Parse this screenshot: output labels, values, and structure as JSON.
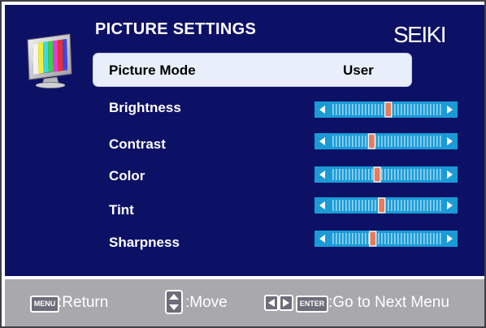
{
  "menu": {
    "title": "PICTURE SETTINGS",
    "brand": "SEIKI",
    "icon": "monitor-color-bars-icon"
  },
  "picture_mode": {
    "label": "Picture Mode",
    "value": "User"
  },
  "settings": [
    {
      "id": "brightness",
      "label": "Brightness",
      "level": 0.52
    },
    {
      "id": "contrast",
      "label": "Contrast",
      "level": 0.37
    },
    {
      "id": "color",
      "label": "Color",
      "level": 0.42
    },
    {
      "id": "tint",
      "label": "Tint",
      "level": 0.46
    },
    {
      "id": "sharpness",
      "label": "Sharpness",
      "level": 0.38
    }
  ],
  "footer": {
    "menu_key": "MENU",
    "return_text": ":Return",
    "move_text": ":Move",
    "enter_key": "ENTER",
    "next_text": ":Go to Next Menu"
  },
  "colors": {
    "panel": "#0d1166",
    "footer": "#a8a8ad",
    "slider_track": "#1a9bd6",
    "slider_ticks": "#b9e3f7",
    "slider_thumb": "#e87b5d",
    "highlight": "#e8eefa"
  }
}
